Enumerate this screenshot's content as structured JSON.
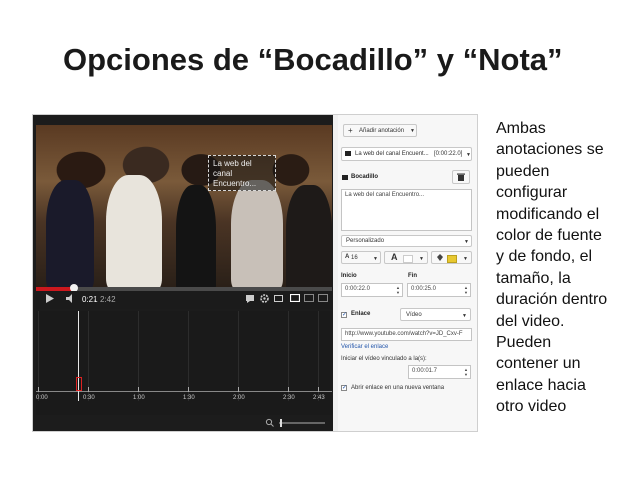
{
  "slide": {
    "title": "Opciones de “Bocadillo” y “Nota”",
    "description_lines": [
      "Ambas",
      "anotaciones se",
      "pueden",
      "configurar",
      "modificando el",
      "color de fuente",
      "y de fondo, el",
      "tamaño, la",
      "duración dentro",
      "del video.",
      "Pueden",
      "contener un",
      "enlace hacia",
      "otro video"
    ]
  },
  "player": {
    "bubble_text": "La web del canal Encuentro...",
    "current_time": "0:21",
    "duration": "2:42",
    "progress_fraction": 0.13
  },
  "timeline": {
    "ticks": [
      "0:00",
      "0:30",
      "1:00",
      "1:30",
      "2:00",
      "2:30",
      "2:43"
    ]
  },
  "panel": {
    "add_annotation": "Añadir anotación",
    "annotation_select": "La web del canal Encuent...",
    "annotation_select_time": "[0:00:22.0]",
    "type_label": "Bocadillo",
    "text_value": "La web del canal Encuentro...",
    "style_select": "Personalizado",
    "font_size": "16",
    "font_glyph": "A",
    "start_label": "Inicio",
    "end_label": "Fin",
    "start_value": "0:00:22.0",
    "end_value": "0:00:25.0",
    "link_label": "Enlace",
    "link_type": "Vídeo",
    "link_url": "http://www.youtube.com/watch?v=JD_Cxv-F",
    "verify_link": "Verificar el enlace",
    "start_at_label": "Iniciar el vídeo vinculado a la(s):",
    "start_at_value": "0:00:01.7",
    "new_window_label": "Abrir enlace en una nueva ventana"
  },
  "colors": {
    "progress": "#cc181e",
    "link": "#2255aa",
    "accent": "#e8c830"
  }
}
